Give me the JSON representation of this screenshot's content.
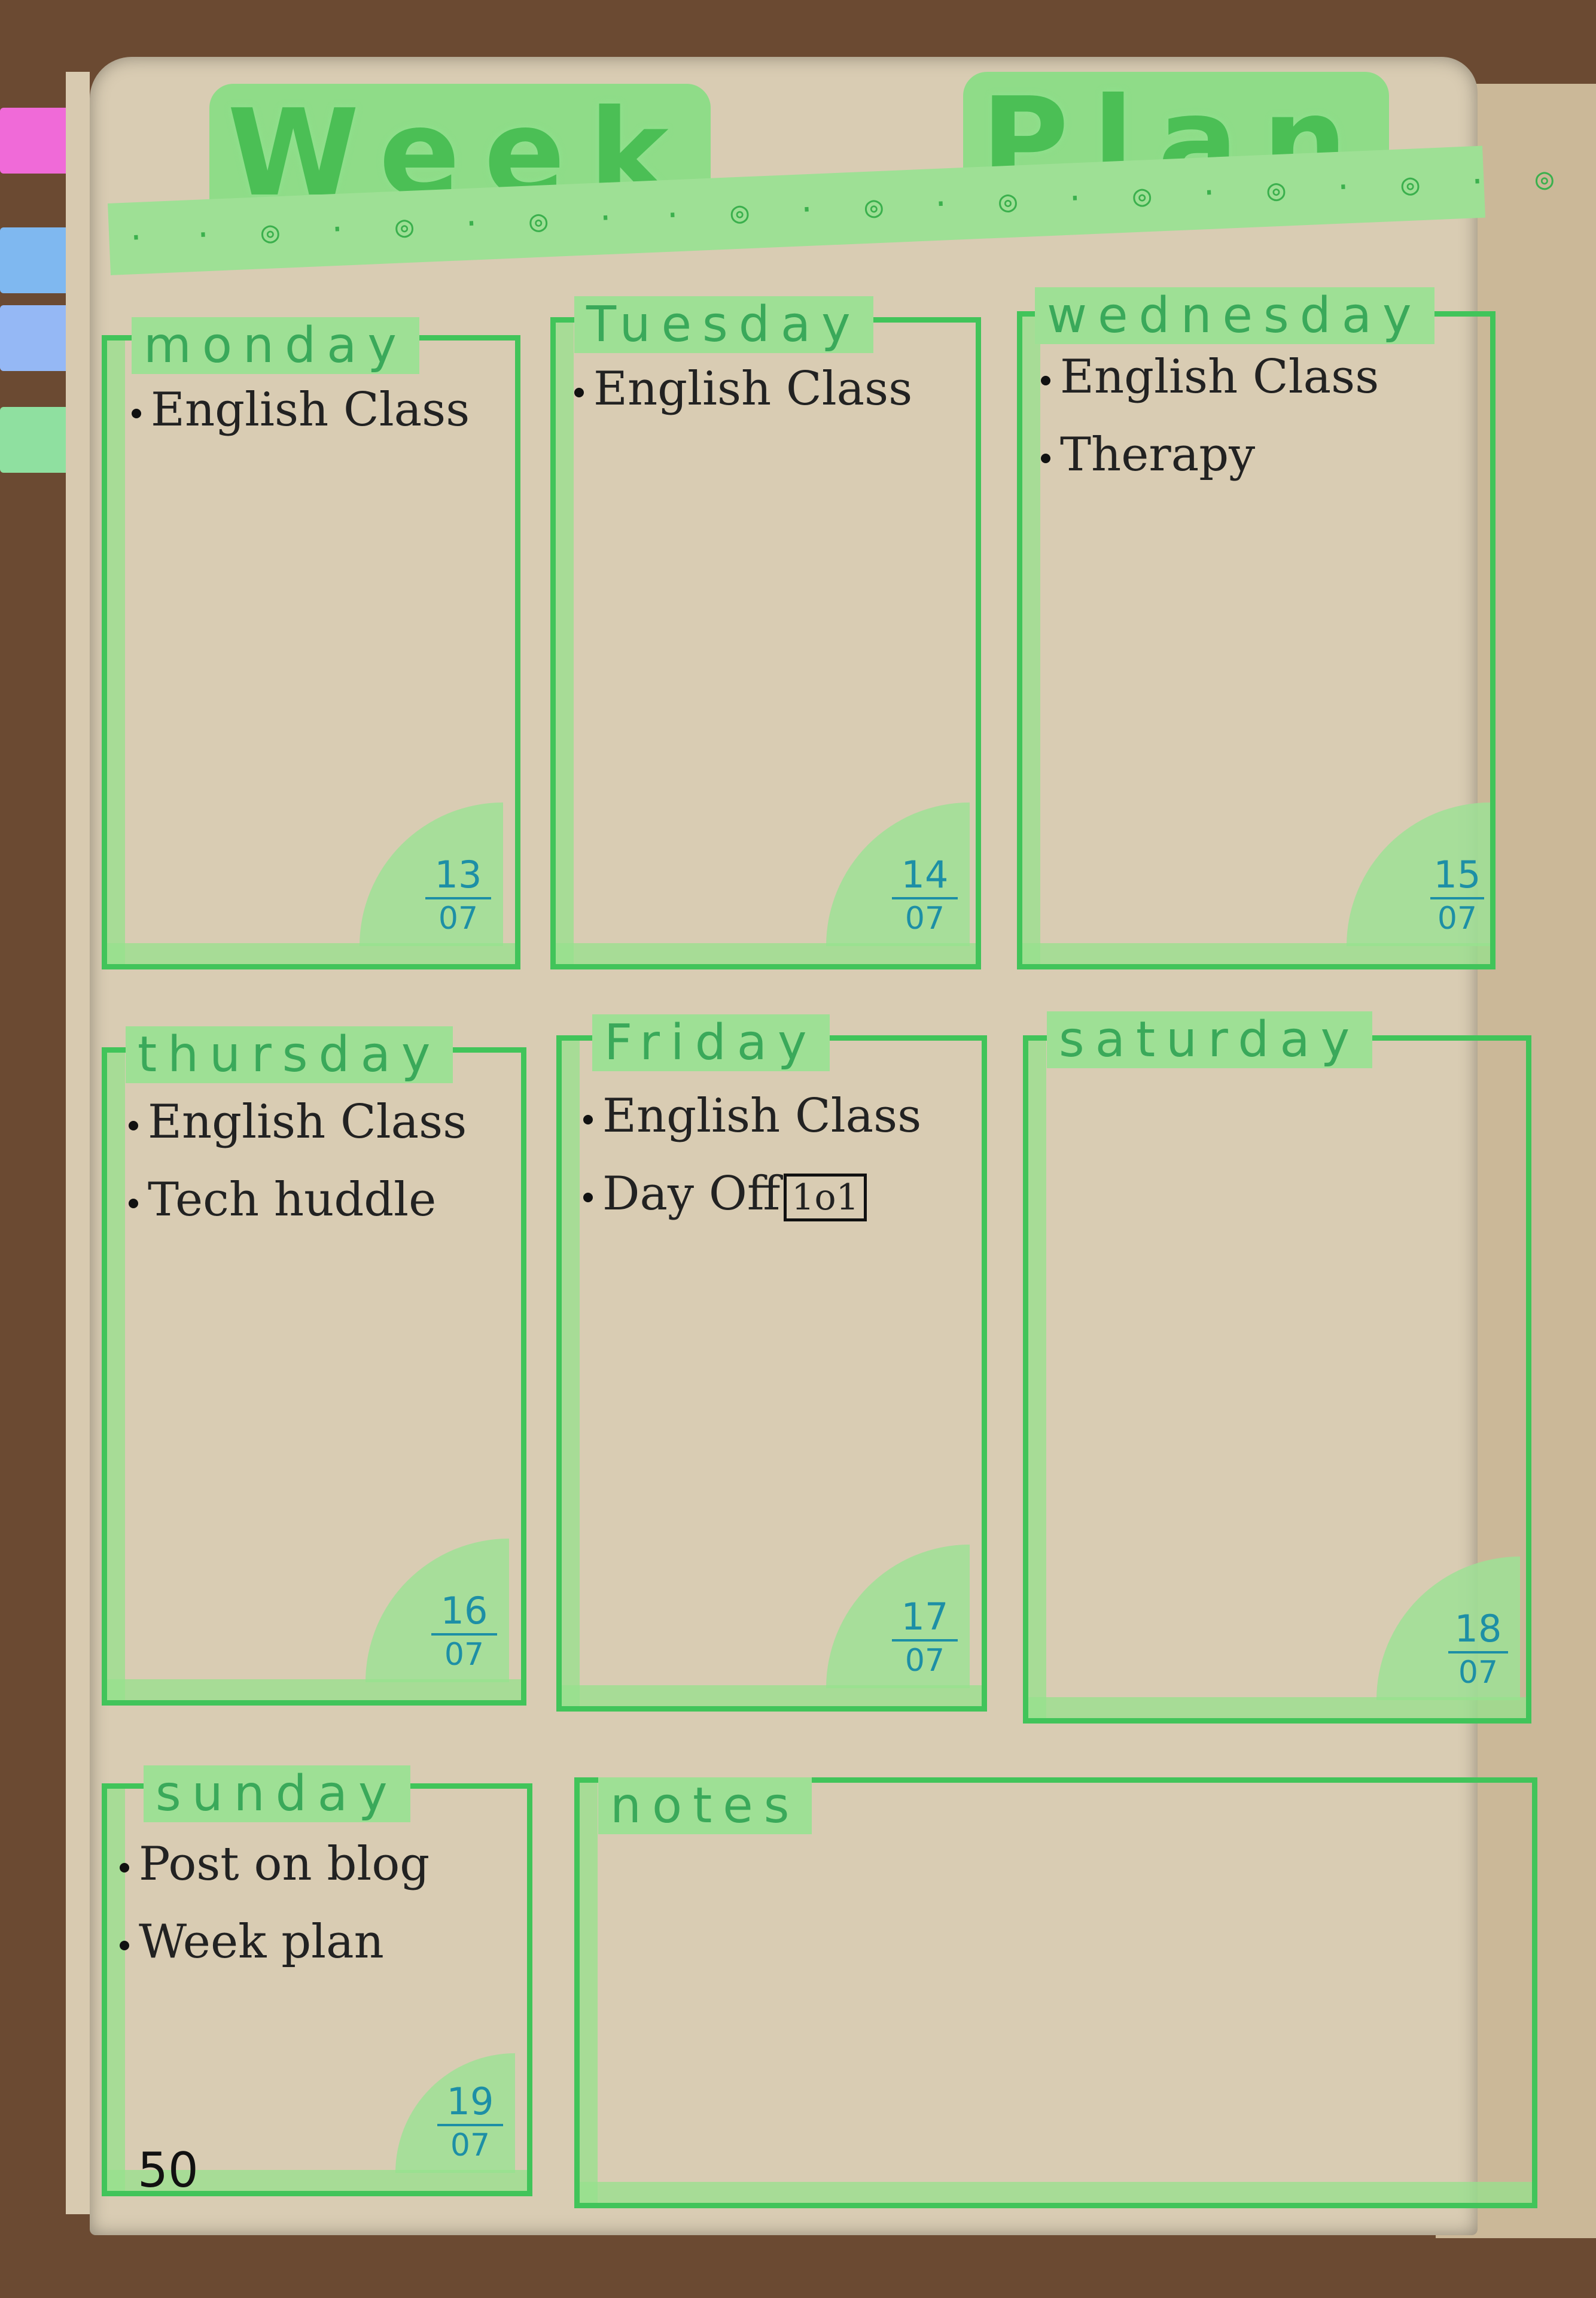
{
  "title": {
    "word1": "Week",
    "word2": "Plan"
  },
  "ribbon_pattern": "· · ◎ · ◎ · ◎ · · ◎ · ◎ · ◎ · ◎ · ◎ · ◎ · ◎ · ◎ · ◎ · ◎",
  "days": [
    {
      "name": "monday",
      "items": [
        "English Class"
      ],
      "date_day": "13",
      "date_month": "07"
    },
    {
      "name": "Tuesday",
      "items": [
        "English Class"
      ],
      "date_day": "14",
      "date_month": "07"
    },
    {
      "name": "wednesday",
      "items": [
        "English Class",
        "Therapy"
      ],
      "date_day": "15",
      "date_month": "07"
    },
    {
      "name": "thursday",
      "items": [
        "English Class",
        "Tech huddle"
      ],
      "date_day": "16",
      "date_month": "07"
    },
    {
      "name": "Friday",
      "items": [
        "English Class",
        "Day Off"
      ],
      "badge": "1o1",
      "date_day": "17",
      "date_month": "07"
    },
    {
      "name": "saturday",
      "items": [],
      "date_day": "18",
      "date_month": "07"
    },
    {
      "name": "sunday",
      "items": [
        "Post on blog",
        "Week plan"
      ],
      "date_day": "19",
      "date_month": "07"
    }
  ],
  "notes": {
    "label": "notes"
  },
  "page_number": "50",
  "colors": {
    "green": "#41c45a",
    "highlight": "#9ee095",
    "date_blue": "#1d8fa6",
    "paper": "#d9ccb3"
  }
}
